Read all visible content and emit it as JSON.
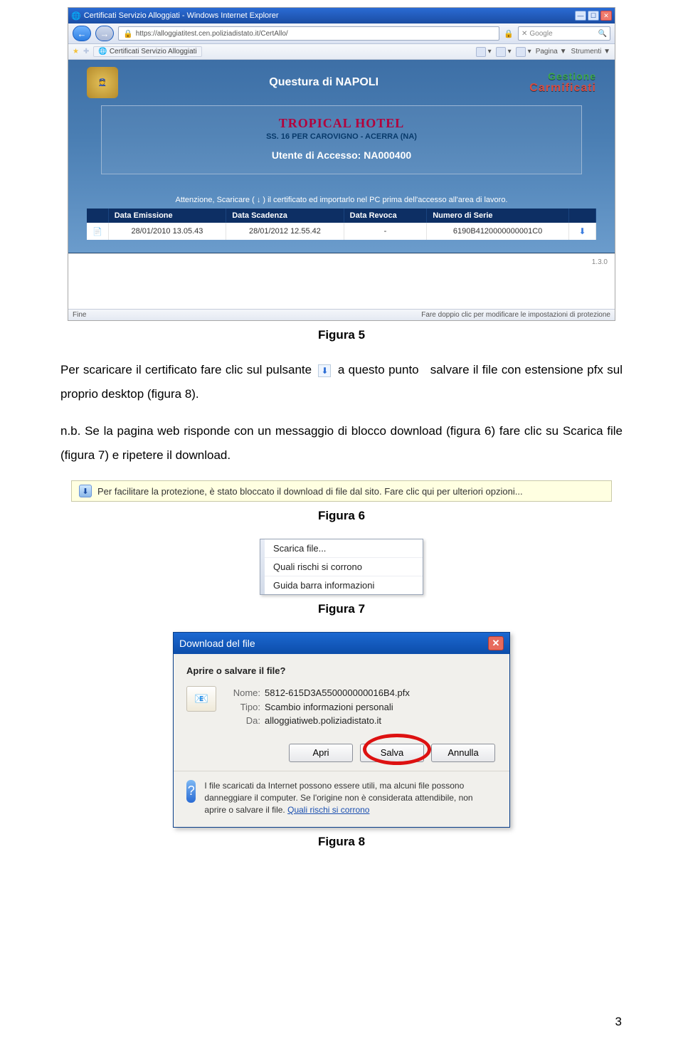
{
  "figure5": {
    "window_title": "Certificati Servizio Alloggiati - Windows Internet Explorer",
    "url": "https://alloggiatitest.cen.poliziadistato.it/CertAllo/",
    "search_placeholder": "Google",
    "tab_label": "Certificati Servizio Alloggiati",
    "tool_home": "▼",
    "tool_pagina": "Pagina ▼",
    "tool_strumenti": "Strumenti ▼",
    "app_title": "Questura di NAPOLI",
    "gestione_1": "Gestione",
    "gestione_2": "Carmificati",
    "hotel_name": "TROPICAL HOTEL",
    "hotel_addr": "SS. 16 PER CAROVIGNO - ACERRA (NA)",
    "utente": "Utente di Accesso: NA000400",
    "attenzione": "Attenzione, Scaricare ( ↓ ) il certificato ed importarlo nel PC prima dell'accesso all'area di lavoro.",
    "th_emissione": "Data Emissione",
    "th_scadenza": "Data Scadenza",
    "th_revoca": "Data Revoca",
    "th_serie": "Numero di Serie",
    "td_emissione": "28/01/2010 13.05.43",
    "td_scadenza": "28/01/2012 12.55.42",
    "td_revoca": "-",
    "td_serie": "6190B4120000000001C0",
    "version": "1.3.0",
    "status_left": "Fine",
    "status_right": "Fare doppio clic per modificare le impostazioni di protezione"
  },
  "captions": {
    "f5": "Figura 5",
    "f6": "Figura 6",
    "f7": "Figura 7",
    "f8": "Figura 8"
  },
  "paragraph1_a": "Per scaricare il certificato fare clic sul pulsante",
  "paragraph1_b": "a questo punto",
  "paragraph1_c": "salvare il file con estensione pfx sul proprio desktop (figura 8).",
  "paragraph2": "n.b. Se la pagina web risponde con un messaggio di blocco download (figura 6) fare clic  su Scarica file (figura 7) e ripetere il download.",
  "figure6_text": "Per facilitare la protezione, è stato bloccato il download di file dal sito. Fare clic qui per ulteriori opzioni...",
  "figure7": {
    "item1": "Scarica file...",
    "item2": "Quali rischi si corrono",
    "item3": "Guida barra informazioni"
  },
  "figure8": {
    "title": "Download del file",
    "question": "Aprire o salvare il file?",
    "name_lbl": "Nome:",
    "name_val": "5812-615D3A550000000016B4.pfx",
    "type_lbl": "Tipo:",
    "type_val": "Scambio informazioni personali",
    "from_lbl": "Da:",
    "from_val": "alloggiatiweb.poliziadistato.it",
    "btn_open": "Apri",
    "btn_save": "Salva",
    "btn_cancel": "Annulla",
    "warn": "I file scaricati da Internet possono essere utili, ma alcuni file possono danneggiare il computer. Se l'origine non è considerata attendibile, non aprire o salvare il file. ",
    "warn_link": "Quali rischi si corrono"
  },
  "page_number": "3"
}
